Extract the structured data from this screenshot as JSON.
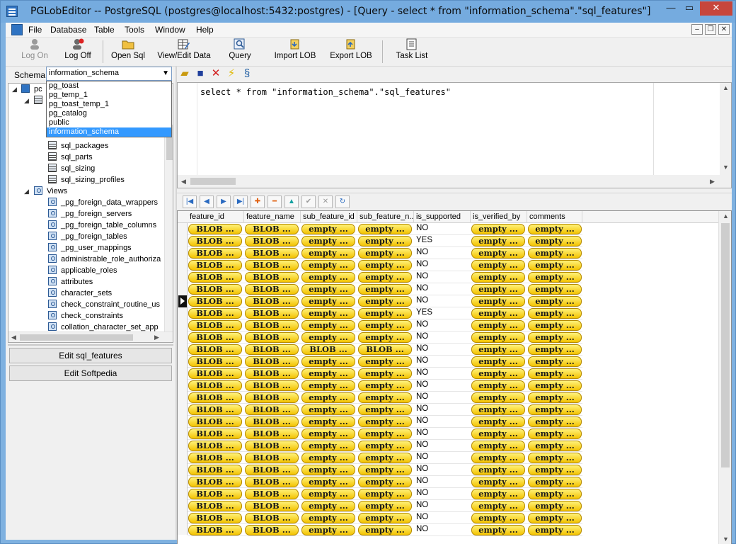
{
  "window": {
    "title": "PGLobEditor -- PostgreSQL (postgres@localhost:5432:postgres) - [Query - select * from \"information_schema\".\"sql_features\"]",
    "close_glyph": "✕",
    "min_glyph": "—",
    "max_glyph": "▭"
  },
  "menu": {
    "items": [
      "File",
      "Database",
      "Table",
      "Tools",
      "Window",
      "Help"
    ],
    "mdi_min": "–",
    "mdi_restore": "❐",
    "mdi_close": "✕"
  },
  "toolbar": {
    "buttons": [
      {
        "label": "Log On",
        "icon": "person-icon",
        "enabled": false
      },
      {
        "label": "Log Off",
        "icon": "person-off-icon",
        "enabled": true
      },
      {
        "label": "Open Sql",
        "icon": "folder-icon",
        "enabled": true
      },
      {
        "label": "View/Edit Data",
        "icon": "edit-data-icon",
        "enabled": true
      },
      {
        "label": "Query",
        "icon": "query-icon",
        "enabled": true
      },
      {
        "label": "Import LOB",
        "icon": "import-icon",
        "enabled": true
      },
      {
        "label": "Export LOB",
        "icon": "export-icon",
        "enabled": true
      },
      {
        "label": "Task List",
        "icon": "task-list-icon",
        "enabled": true
      }
    ]
  },
  "schema": {
    "label": "Schema",
    "selected": "information_schema",
    "options": [
      "pg_toast",
      "pg_temp_1",
      "pg_toast_temp_1",
      "pg_catalog",
      "public",
      "information_schema"
    ]
  },
  "tree": {
    "root_partial": "pc",
    "tables": [
      "sql_packages",
      "sql_parts",
      "sql_sizing",
      "sql_sizing_profiles"
    ],
    "views_label": "Views",
    "views": [
      "_pg_foreign_data_wrappers",
      "_pg_foreign_servers",
      "_pg_foreign_table_columns",
      "_pg_foreign_tables",
      "_pg_user_mappings",
      "administrable_role_authoriza",
      "applicable_roles",
      "attributes",
      "character_sets",
      "check_constraint_routine_us",
      "check_constraints",
      "collation_character_set_app"
    ]
  },
  "side_buttons": [
    "Edit sql_features",
    "Edit Softpedia"
  ],
  "query": {
    "sql": "select * from \"information_schema\".\"sql_features\""
  },
  "grid": {
    "columns": [
      "feature_id",
      "feature_name",
      "sub_feature_id",
      "sub_feature_n...",
      "is_supported",
      "is_verified_by",
      "comments"
    ],
    "rows": [
      [
        "BLOB ...",
        "BLOB ...",
        "empty ...",
        "empty ...",
        "NO",
        "empty ...",
        "empty ..."
      ],
      [
        "BLOB ...",
        "BLOB ...",
        "empty ...",
        "empty ...",
        "YES",
        "empty ...",
        "empty ..."
      ],
      [
        "BLOB ...",
        "BLOB ...",
        "empty ...",
        "empty ...",
        "NO",
        "empty ...",
        "empty ..."
      ],
      [
        "BLOB ...",
        "BLOB ...",
        "empty ...",
        "empty ...",
        "NO",
        "empty ...",
        "empty ..."
      ],
      [
        "BLOB ...",
        "BLOB ...",
        "empty ...",
        "empty ...",
        "NO",
        "empty ...",
        "empty ..."
      ],
      [
        "BLOB ...",
        "BLOB ...",
        "empty ...",
        "empty ...",
        "NO",
        "empty ...",
        "empty ..."
      ],
      [
        "BLOB ...",
        "BLOB ...",
        "empty ...",
        "empty ...",
        "NO",
        "empty ...",
        "empty ..."
      ],
      [
        "BLOB ...",
        "BLOB ...",
        "empty ...",
        "empty ...",
        "YES",
        "empty ...",
        "empty ..."
      ],
      [
        "BLOB ...",
        "BLOB ...",
        "empty ...",
        "empty ...",
        "NO",
        "empty ...",
        "empty ..."
      ],
      [
        "BLOB ...",
        "BLOB ...",
        "empty ...",
        "empty ...",
        "NO",
        "empty ...",
        "empty ..."
      ],
      [
        "BLOB ...",
        "BLOB ...",
        "BLOB ...",
        "BLOB ...",
        "NO",
        "empty ...",
        "empty ..."
      ],
      [
        "BLOB ...",
        "BLOB ...",
        "empty ...",
        "empty ...",
        "NO",
        "empty ...",
        "empty ..."
      ],
      [
        "BLOB ...",
        "BLOB ...",
        "empty ...",
        "empty ...",
        "NO",
        "empty ...",
        "empty ..."
      ],
      [
        "BLOB ...",
        "BLOB ...",
        "empty ...",
        "empty ...",
        "NO",
        "empty ...",
        "empty ..."
      ],
      [
        "BLOB ...",
        "BLOB ...",
        "empty ...",
        "empty ...",
        "NO",
        "empty ...",
        "empty ..."
      ],
      [
        "BLOB ...",
        "BLOB ...",
        "empty ...",
        "empty ...",
        "NO",
        "empty ...",
        "empty ..."
      ],
      [
        "BLOB ...",
        "BLOB ...",
        "empty ...",
        "empty ...",
        "NO",
        "empty ...",
        "empty ..."
      ],
      [
        "BLOB ...",
        "BLOB ...",
        "empty ...",
        "empty ...",
        "NO",
        "empty ...",
        "empty ..."
      ],
      [
        "BLOB ...",
        "BLOB ...",
        "empty ...",
        "empty ...",
        "NO",
        "empty ...",
        "empty ..."
      ],
      [
        "BLOB ...",
        "BLOB ...",
        "empty ...",
        "empty ...",
        "NO",
        "empty ...",
        "empty ..."
      ],
      [
        "BLOB ...",
        "BLOB ...",
        "empty ...",
        "empty ...",
        "NO",
        "empty ...",
        "empty ..."
      ],
      [
        "BLOB ...",
        "BLOB ...",
        "empty ...",
        "empty ...",
        "NO",
        "empty ...",
        "empty ..."
      ],
      [
        "BLOB ...",
        "BLOB ...",
        "empty ...",
        "empty ...",
        "NO",
        "empty ...",
        "empty ..."
      ],
      [
        "BLOB ...",
        "BLOB ...",
        "empty ...",
        "empty ...",
        "NO",
        "empty ...",
        "empty ..."
      ],
      [
        "BLOB ...",
        "BLOB ...",
        "empty ...",
        "empty ...",
        "NO",
        "empty ...",
        "empty ..."
      ],
      [
        "BLOB ...",
        "BLOB ...",
        "empty ...",
        "empty ...",
        "NO",
        "empty ...",
        "empty ..."
      ]
    ],
    "current_row": 6,
    "pill_columns": [
      0,
      1,
      2,
      3,
      5,
      6
    ]
  },
  "colors": {
    "title_bar": "#75abdf",
    "pill_yellow": "#f3c200",
    "selection": "#3399ff",
    "close_red": "#c7463c"
  }
}
